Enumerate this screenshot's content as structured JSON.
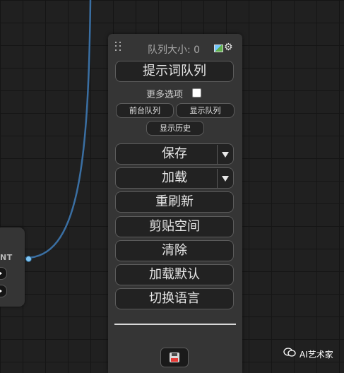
{
  "panel": {
    "queue_size_label": "队列大小: 0",
    "image_icon": "image-icon",
    "gear_icon": "gear-icon",
    "buttons": {
      "queue_prompt": "提示词队列",
      "more_options": "更多选项",
      "front_queue": "前台队列",
      "show_queue": "显示队列",
      "show_history": "显示历史",
      "save": "保存",
      "load": "加载",
      "refresh": "重刷新",
      "clipspace": "剪贴空间",
      "clear": "清除",
      "load_default": "加载默认",
      "switch_language": "切换语言"
    },
    "save_icon": "floppy-disk-icon"
  },
  "node": {
    "output_label": "NT"
  },
  "watermark": {
    "text": "AI艺术家",
    "icon": "wechat-icon"
  },
  "colors": {
    "canvas_bg": "#202020",
    "panel_bg": "#353535",
    "wire": "#3a6fa3",
    "button_bg": "#222222"
  }
}
